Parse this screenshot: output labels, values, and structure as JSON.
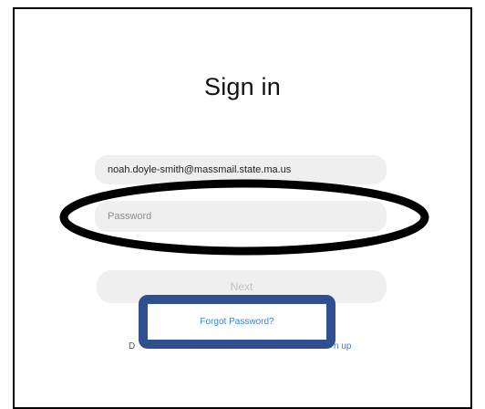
{
  "signin": {
    "title": "Sign in",
    "email_value": "noah.doyle-smith@massmail.state.ma.us",
    "password_placeholder": "Password",
    "next_label": "Next",
    "forgot_password_label": "Forgot Password?",
    "signup_left_fragment": "D",
    "signup_right_fragment": "n up"
  },
  "colors": {
    "annotation_ellipse": "#000000",
    "annotation_box": "#2f4f8f",
    "link": "#3b7de0",
    "field_background": "#efefef"
  }
}
